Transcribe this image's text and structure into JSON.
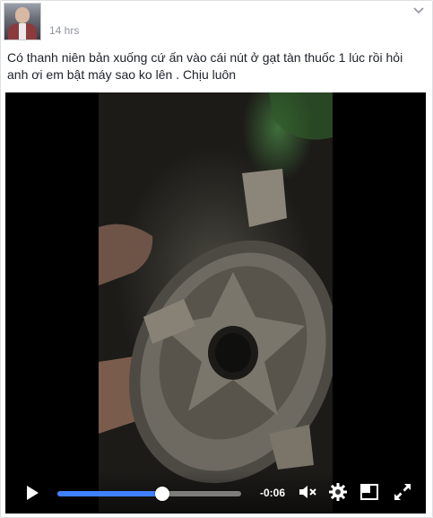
{
  "post": {
    "timestamp": "14 hrs",
    "text_line1": "Có thanh niên bản xuống cứ ấn vào cái nút ở gạt tàn thuốc 1 lúc rồi hỏi",
    "text_line2": "anh ơi em bật máy sao ko lên . Chịu luôn"
  },
  "video": {
    "time_remaining": "-0:06",
    "progress": 0.57,
    "accent_color": "#4080ff"
  },
  "icons": {
    "menu": "chevron-down-icon",
    "play": "play-icon",
    "mute": "volume-muted-icon",
    "settings": "gear-icon",
    "pip": "picture-in-picture-icon",
    "fullscreen": "fullscreen-icon"
  }
}
